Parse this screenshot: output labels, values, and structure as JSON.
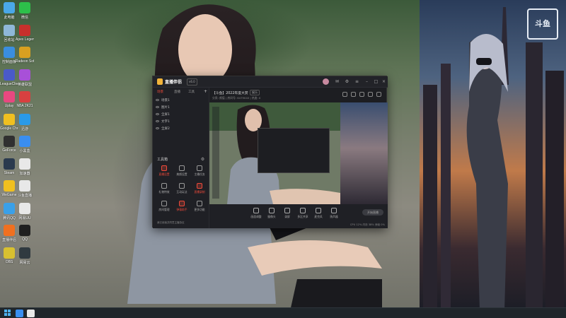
{
  "desktop": {
    "icons": [
      {
        "label": "此电脑",
        "color": "#4aa8e8",
        "icon": "computer-icon"
      },
      {
        "label": "微信",
        "color": "#2dc04a",
        "icon": "wechat-icon"
      },
      {
        "label": "回收站",
        "color": "#8fb8d8",
        "icon": "recycle-bin-icon"
      },
      {
        "label": "Apex Legends",
        "color": "#c8302c",
        "icon": "apex-icon"
      },
      {
        "label": "控制面板",
        "color": "#3a8ee0",
        "icon": "control-panel-icon"
      },
      {
        "label": "Radeon Software",
        "color": "#d8a020",
        "icon": "amd-icon"
      },
      {
        "label": "LeagueClient",
        "color": "#4a5ac8",
        "icon": "league-icon"
      },
      {
        "label": "英雄联盟",
        "color": "#a850d8",
        "icon": "lol-icon"
      },
      {
        "label": "Uplay",
        "color": "#e84880",
        "icon": "uplay-icon"
      },
      {
        "label": "NBA 2K21",
        "color": "#d84040",
        "icon": "nba-icon"
      },
      {
        "label": "Google Chrome",
        "color": "#f0c020",
        "icon": "chrome-icon"
      },
      {
        "label": "迅游",
        "color": "#2a9ae8",
        "icon": "booster-icon"
      },
      {
        "label": "GeForce",
        "color": "#303030",
        "icon": "geforce-icon"
      },
      {
        "label": "小黑盒",
        "color": "#3a8ef0",
        "icon": "heybox-icon"
      },
      {
        "label": "Steam",
        "color": "#2a3a4e",
        "icon": "steam-icon"
      },
      {
        "label": "加速器",
        "color": "#e8e8e8",
        "icon": "accelerator-icon"
      },
      {
        "label": "WeGame",
        "color": "#f0c020",
        "icon": "wegame-icon"
      },
      {
        "label": "斗鱼直播",
        "color": "#e8e8e8",
        "icon": "douyu-icon"
      },
      {
        "label": "腾讯QQ",
        "color": "#3aa0e8",
        "icon": "qq-icon"
      },
      {
        "label": "网易UU",
        "color": "#e8e8e8",
        "icon": "uu-icon"
      },
      {
        "label": "直播伴侣",
        "color": "#f07020",
        "icon": "live-companion-icon"
      },
      {
        "label": "QQ",
        "color": "#202020",
        "icon": "qq-penguin-icon"
      },
      {
        "label": "OBS",
        "color": "#d8c030",
        "icon": "obs-icon"
      },
      {
        "label": "网易云",
        "color": "#303a40",
        "icon": "music-icon"
      }
    ]
  },
  "poster": {
    "logo": "斗鱼"
  },
  "app": {
    "title": "直播伴侣",
    "version": "v6.0",
    "tabs": [
      "场景",
      "直播",
      "工具"
    ],
    "scenes": [
      "场景1",
      "图片1",
      "全屏1",
      "文字1",
      "全屏2"
    ],
    "toolbox_label": "工具箱",
    "tools": [
      {
        "label": "直播设置",
        "red": true
      },
      {
        "label": "美颜设置",
        "red": false
      },
      {
        "label": "主播任务",
        "red": false
      },
      {
        "label": "礼物特效",
        "red": false
      },
      {
        "label": "互动玩法",
        "red": false
      },
      {
        "label": "直播录制",
        "red": true
      },
      {
        "label": "房间管理",
        "red": false
      },
      {
        "label": "弹幕助手",
        "red": true
      },
      {
        "label": "更多功能",
        "red": false
      }
    ],
    "agree_text": "我已阅读并同意主播协议",
    "room_title": "【斗鱼】2022年度大赏",
    "room_badge": "娱乐",
    "room_meta": "分类: 颜值 | 房间号: 6479040 | 热度: 0",
    "bottom_buttons": [
      "画面调整",
      "摄像头",
      "录屏",
      "多区共享",
      "麦克风",
      "扬声器"
    ],
    "start_live": "开始直播",
    "status": "CPU 12%   内存 38%   丢帧 0%"
  },
  "taskbar": {
    "apps": [
      {
        "color": "#3a8ef0",
        "icon": "search-icon"
      },
      {
        "color": "#e8e8e8",
        "icon": "task-view-icon"
      }
    ]
  }
}
